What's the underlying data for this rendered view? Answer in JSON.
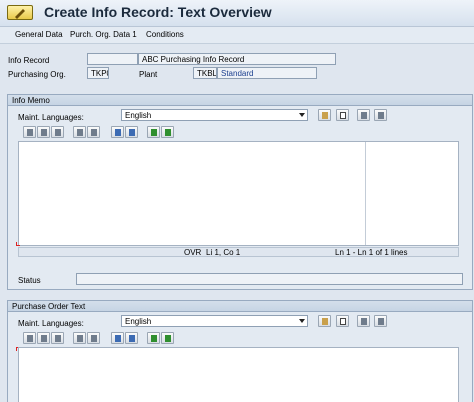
{
  "window": {
    "title": "Create Info Record: Text Overview"
  },
  "tabs": [
    "General Data",
    "Purch. Org. Data 1",
    "Conditions"
  ],
  "fields": {
    "info_record_label": "Info Record",
    "info_record_value": "",
    "info_record_text": "ABC Purchasing Info Record",
    "purch_org_label": "Purchasing Org.",
    "purch_org_value": "TKP0",
    "plant_label": "Plant",
    "plant_value": "TKBL",
    "plant_text": "Standard"
  },
  "info_memo": {
    "title": "Info Memo",
    "lang_label": "Maint. Languages:",
    "lang_value": "English",
    "status_ovr": "OVR",
    "status_pos": "Li 1, Co 1",
    "status_lines": "Ln 1 - Ln 1 of 1 lines",
    "status_label": "Status"
  },
  "purchase_order_text": {
    "title": "Purchase Order Text",
    "lang_label": "Maint. Languages:",
    "lang_value": "English"
  },
  "icons": {
    "toolbar_left": [
      "cut-icon",
      "copy-icon",
      "paste-icon",
      "undo-icon",
      "redo-icon",
      "find-icon",
      "find-next-icon",
      "import-icon",
      "export-icon"
    ],
    "toolbar_right": [
      "delete-icon",
      "new-document-icon",
      "edit-icon",
      "copy-text-icon"
    ]
  }
}
